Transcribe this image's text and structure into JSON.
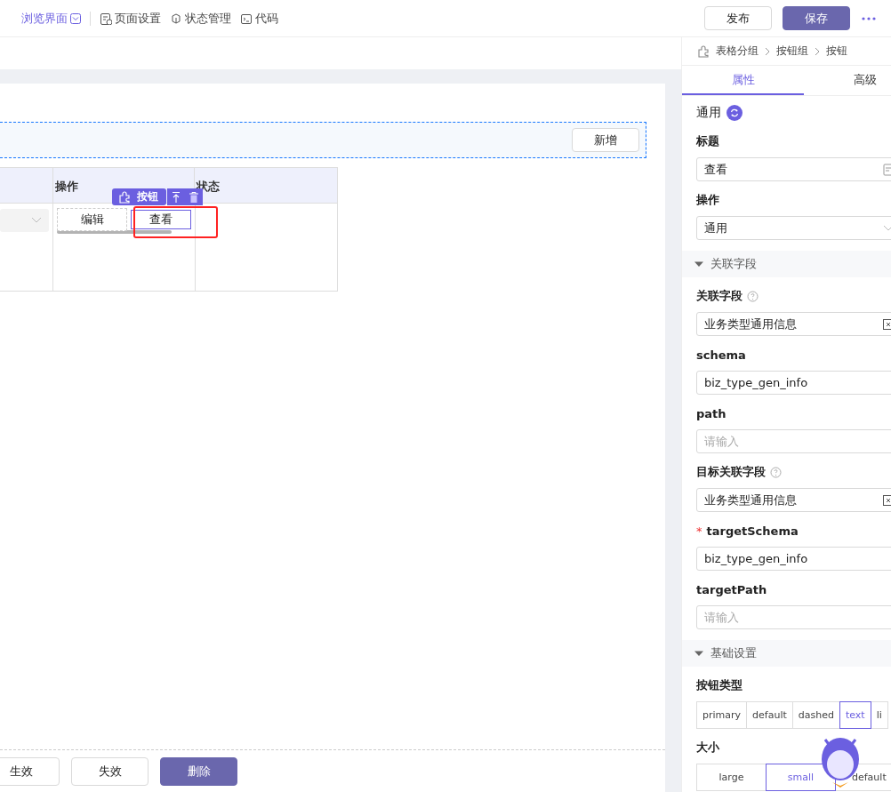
{
  "top_bar": {
    "nav": [
      {
        "label": "浏览界面",
        "selected": true
      },
      {
        "label": "页面设置",
        "selected": false
      },
      {
        "label": "状态管理",
        "selected": false
      },
      {
        "label": "代码",
        "selected": false
      }
    ],
    "buttons": [
      {
        "label": "发布",
        "kind": "default"
      },
      {
        "label": "保存",
        "kind": "primary"
      }
    ]
  },
  "canvas": {
    "toolbar": {
      "button": "新增"
    },
    "table": {
      "columns": [
        {
          "label": "操作"
        },
        {
          "label": "状态"
        }
      ],
      "rows": [
        {
          "column_1": {
            "kind": "select"
          },
          "actions": [
            {
              "label": "编辑",
              "selected": false
            },
            {
              "label": "查看",
              "selected": true
            }
          ]
        }
      ]
    },
    "selection_tag": {
      "label": "按钮"
    },
    "footer_buttons": [
      {
        "label": "生效",
        "kind": "default"
      },
      {
        "label": "失效",
        "kind": "default"
      },
      {
        "label": "删除",
        "kind": "primary"
      }
    ]
  },
  "panel": {
    "breadcrumb": [
      "表格分组",
      "按钮组",
      "按钮"
    ],
    "tabs": [
      {
        "label": "属性",
        "selected": true
      },
      {
        "label": "高级",
        "selected": false
      }
    ],
    "items": [
      {
        "kind": "section",
        "label": "通用"
      },
      {
        "kind": "input",
        "label": "标题",
        "value": "查看",
        "has_addon": true
      },
      {
        "kind": "select",
        "label": "操作",
        "value": "通用"
      },
      {
        "kind": "group",
        "label": "关联字段",
        "expanded": true
      },
      {
        "kind": "input",
        "label": "关联字段",
        "value": "业务类型通用信息",
        "help": true,
        "clearable": true
      },
      {
        "kind": "input",
        "label": "schema",
        "value": "biz_type_gen_info"
      },
      {
        "kind": "input",
        "label": "path",
        "placeholder": "请输入"
      },
      {
        "kind": "input",
        "label": "目标关联字段",
        "value": "业务类型通用信息",
        "help": true,
        "clearable": true
      },
      {
        "kind": "input",
        "label": "targetSchema",
        "value": "biz_type_gen_info",
        "required_mark": "*"
      },
      {
        "kind": "input",
        "label": "targetPath",
        "placeholder": "请输入"
      },
      {
        "kind": "group",
        "label": "基础设置",
        "expanded": true
      },
      {
        "kind": "segmented",
        "label": "按钮类型",
        "options": [
          {
            "label": "primary",
            "selected": false
          },
          {
            "label": "default",
            "selected": false
          },
          {
            "label": "dashed",
            "selected": false
          },
          {
            "label": "text",
            "selected": true
          },
          {
            "label": "li",
            "selected": false
          }
        ]
      },
      {
        "kind": "segmented",
        "label": "大小",
        "options": [
          {
            "label": "large",
            "selected": false
          },
          {
            "label": "small",
            "selected": true
          },
          {
            "label": "default",
            "selected": false
          }
        ]
      }
    ]
  }
}
